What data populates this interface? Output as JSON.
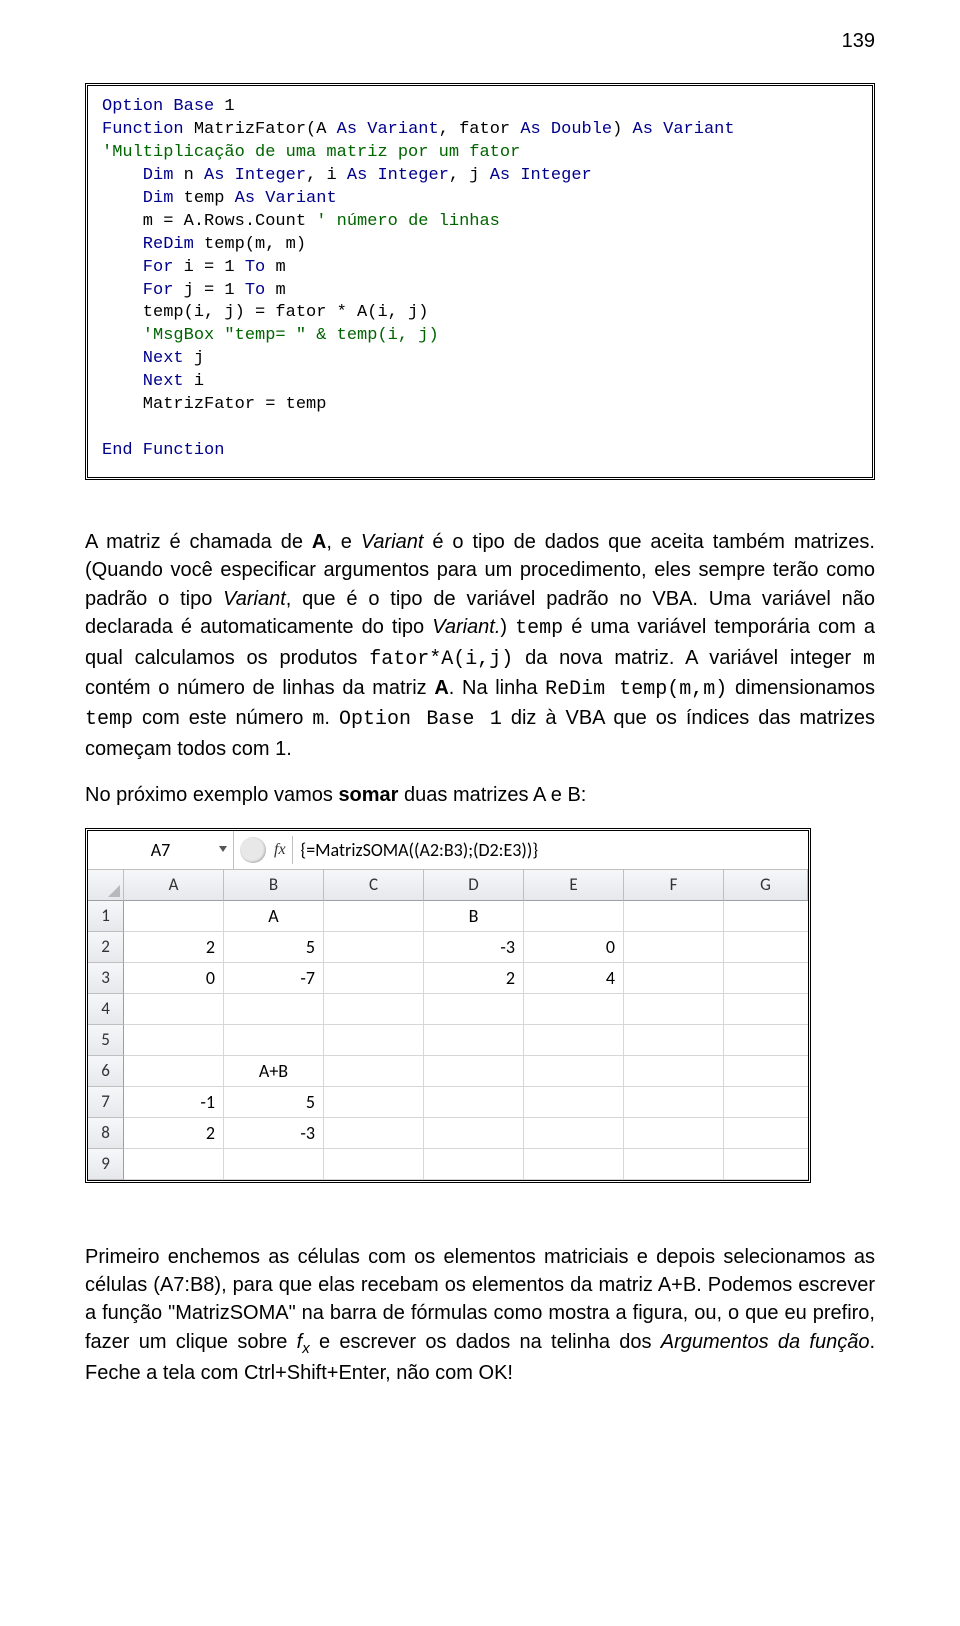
{
  "page_number": "139",
  "code": {
    "l1a": "Option Base",
    "l1b": " 1",
    "l2a": "Function",
    "l2b": " MatrizFator(A ",
    "l2c": "As Variant",
    "l2d": ", fator ",
    "l2e": "As Double",
    "l2f": ") ",
    "l2g": "As Variant",
    "l3": "'Multiplicação de uma matriz por um fator",
    "l4a": "    Dim",
    "l4b": " n ",
    "l4c": "As Integer",
    "l4d": ", i ",
    "l4e": "As Integer",
    "l4f": ", j ",
    "l4g": "As Integer",
    "l5a": "    Dim",
    "l5b": " temp ",
    "l5c": "As Variant",
    "l6a": "    m = A.Rows.Count ",
    "l6b": "' número de linhas",
    "l7a": "    ReDim",
    "l7b": " temp(m, m)",
    "l8a": "    For",
    "l8b": " i = 1 ",
    "l8c": "To",
    "l8d": " m",
    "l9a": "    For",
    "l9b": " j = 1 ",
    "l9c": "To",
    "l9d": " m",
    "l10": "    temp(i, j) = fator * A(i, j)",
    "l11": "    'MsgBox \"temp= \" & temp(i, j)",
    "l12a": "    Next",
    "l12b": " j",
    "l13a": "    Next",
    "l13b": " i",
    "l14": "    MatrizFator = temp",
    "blank": "    ",
    "l15": "End Function"
  },
  "para1": {
    "t1": "A matriz é chamada de ",
    "t2": "A",
    "t3": ", e ",
    "t4": "Variant",
    "t5": " é o tipo de dados que aceita também matrizes. (Quando você especificar argumentos para um procedimento, eles sempre terão como padrão o tipo ",
    "t6": "Variant",
    "t7": ", que é o tipo de variável padrão no VBA. Uma variável não declarada é automaticamente do tipo ",
    "t8": "Variant.",
    "t9": ") ",
    "c1": "temp",
    "t10": " é uma variável temporária com a qual calculamos os produtos ",
    "c2": "fator*A(i,j)",
    "t11": " da nova matriz. A variável integer ",
    "c3": "m",
    "t12": " contém o número de linhas da matriz ",
    "t13": "A",
    "t14": ". Na linha ",
    "c4": "ReDim temp(m,m)",
    "t15": " dimensionamos ",
    "c5": "temp",
    "t16": " com este número ",
    "c6": "m",
    "t17": ". ",
    "c7": "Option Base 1",
    "t18": " diz à VBA que os índices das matrizes começam todos com 1."
  },
  "para2": {
    "t1": "No próximo exemplo vamos ",
    "t2": "somar",
    "t3": " duas matrizes A e B:"
  },
  "excel": {
    "namebox": "A7",
    "fx": "fx",
    "formula": "{=MatrizSOMA((A2:B3);(D2:E3))}",
    "cols": [
      "A",
      "B",
      "C",
      "D",
      "E",
      "F",
      "G"
    ],
    "rows": [
      "1",
      "2",
      "3",
      "4",
      "5",
      "6",
      "7",
      "8",
      "9"
    ],
    "r1": {
      "b": "A",
      "d": "B"
    },
    "r2": {
      "a": "2",
      "b": "5",
      "d": "-3",
      "e": "0"
    },
    "r3": {
      "a": "0",
      "b": "-7",
      "d": "2",
      "e": "4"
    },
    "r6": {
      "b": "A+B"
    },
    "r7": {
      "a": "-1",
      "b": "5"
    },
    "r8": {
      "a": "2",
      "b": "-3"
    }
  },
  "para3": {
    "t1": "Primeiro enchemos as células com os elementos matriciais e depois selecionamos as células (A7:B8), para que elas recebam os elementos da matriz A+B. Podemos escrever a função \"MatrizSOMA\" na barra de fórmulas como mostra a figura, ou, o que eu prefiro, fazer um clique sobre ",
    "fxi": "f",
    "fxs": "x",
    "t2": "  e escrever os dados na telinha dos ",
    "t3": "Argumentos da função",
    "t4": ". Feche a tela com Ctrl+Shift+Enter, não com OK!"
  }
}
